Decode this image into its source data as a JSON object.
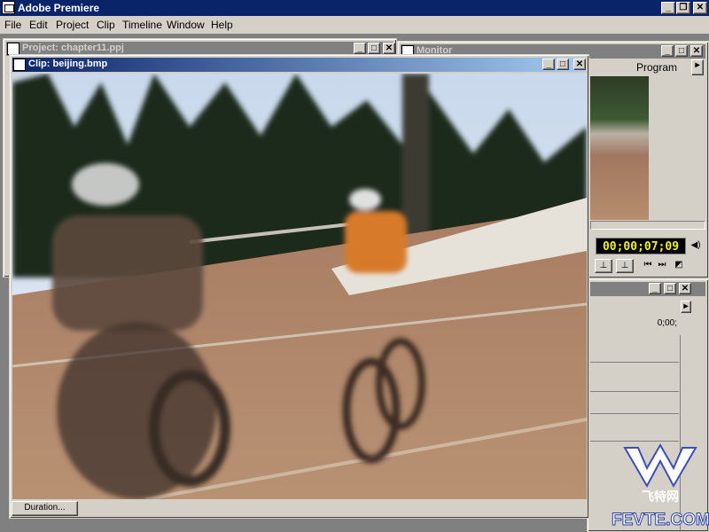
{
  "app": {
    "title": "Adobe Premiere",
    "window_buttons": [
      "_",
      "❐",
      "✕"
    ]
  },
  "menu": [
    "File",
    "Edit",
    "Project",
    "Clip",
    "Timeline",
    "Window",
    "Help"
  ],
  "project_window": {
    "title": "Project: chapter11.ppj"
  },
  "monitor_window": {
    "title": "Monitor",
    "tab": "Program",
    "timecode": "00;00;07;09",
    "timeline_readout": "0;00;"
  },
  "clip_window": {
    "title": "Clip: beijing.bmp",
    "duration_button": "Duration..."
  },
  "watermark": {
    "chinese": "飞特网",
    "text": "FEVTE.COM"
  },
  "colors": {
    "active_title": "#0a246a",
    "inactive_title": "#808080",
    "face": "#d4d0c8",
    "timecode_text": "#f0f020"
  }
}
